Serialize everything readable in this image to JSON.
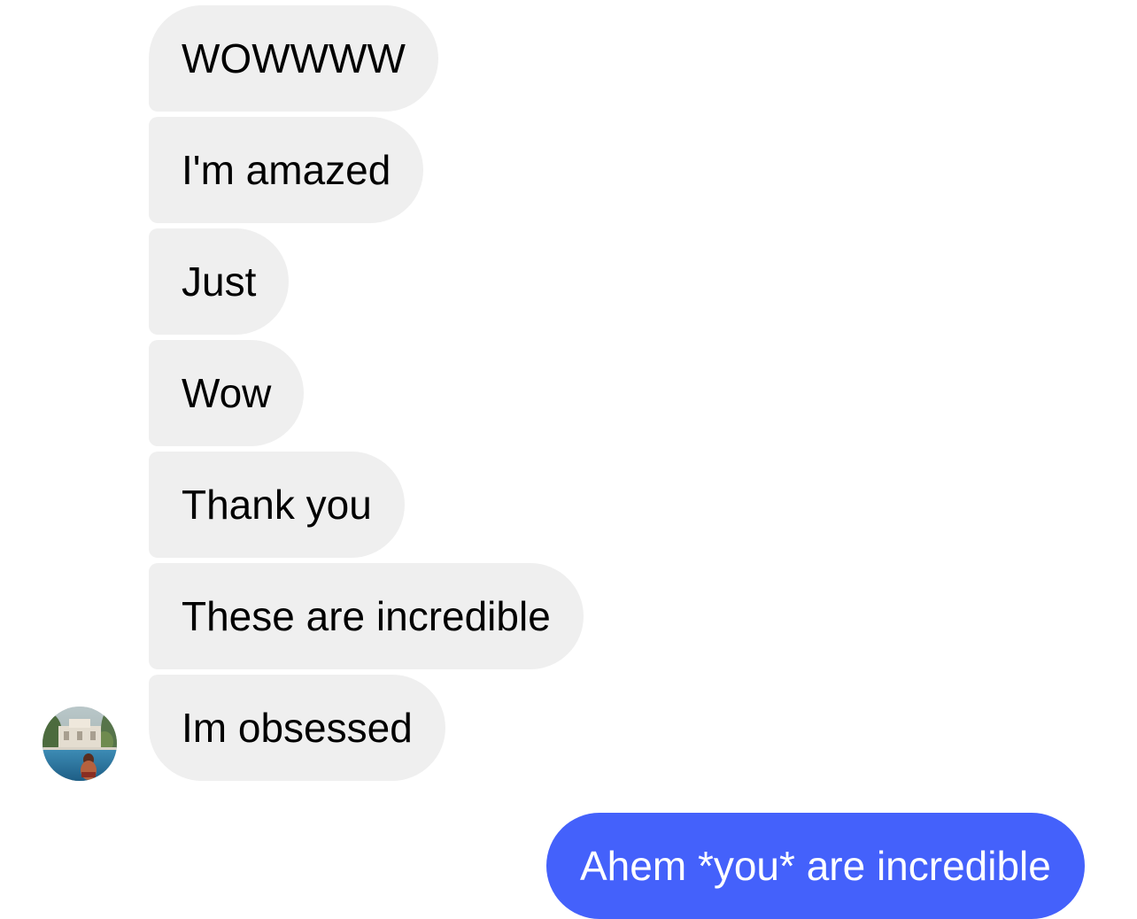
{
  "conversation": {
    "incoming_messages": [
      {
        "text": "WOWWWW"
      },
      {
        "text": "I'm amazed"
      },
      {
        "text": "Just"
      },
      {
        "text": "Wow"
      },
      {
        "text": "Thank you"
      },
      {
        "text": "These are incredible"
      },
      {
        "text": "Im obsessed"
      }
    ],
    "outgoing_messages": [
      {
        "text": "Ahem *you* are incredible"
      }
    ],
    "contact": {
      "avatar_icon": "contact-avatar-photo"
    }
  },
  "colors": {
    "incoming_bubble": "#efefef",
    "outgoing_bubble": "#4461fb",
    "incoming_text": "#000000",
    "outgoing_text": "#ffffff"
  }
}
